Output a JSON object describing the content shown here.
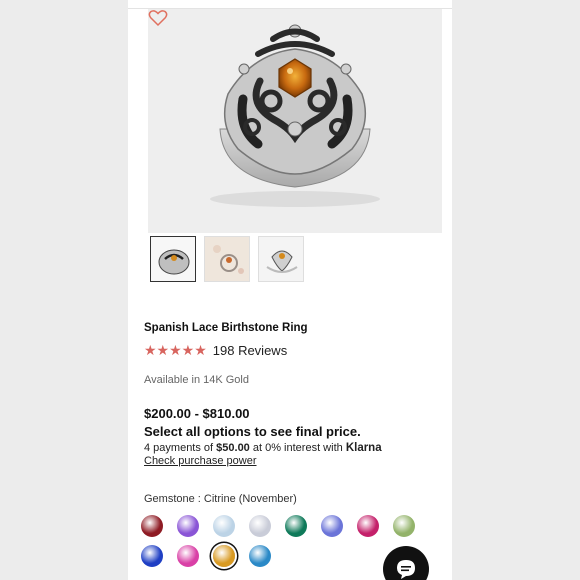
{
  "product": {
    "title": "Spanish Lace Birthstone Ring",
    "stars": "★★★★★",
    "rating_value": 5,
    "reviews": "198 Reviews",
    "availability": "Available in 14K Gold",
    "price_range": "$200.00 - $810.00",
    "select_note": "Select all options to see final price.",
    "klarna_prefix": "4 payments of ",
    "klarna_amount": "$50.00",
    "klarna_mid": " at 0% interest with ",
    "klarna_brand": "Klarna",
    "check_link": "Check purchase power"
  },
  "gemstone": {
    "label": "Gemstone : Citrine (November)",
    "swatches": [
      {
        "name": "garnet",
        "color": "#8e1b24"
      },
      {
        "name": "amethyst",
        "color": "#8a55d6"
      },
      {
        "name": "aquamarine",
        "color": "#bcd3e6"
      },
      {
        "name": "diamond",
        "color": "#c9ccd8"
      },
      {
        "name": "emerald",
        "color": "#0f7a5a"
      },
      {
        "name": "alexandrite",
        "color": "#6b74d8"
      },
      {
        "name": "ruby",
        "color": "#c4206a"
      },
      {
        "name": "peridot",
        "color": "#93b36a"
      },
      {
        "name": "sapphire",
        "color": "#1f3fc4"
      },
      {
        "name": "pink-tourmaline",
        "color": "#d940a6"
      },
      {
        "name": "citrine",
        "color": "#d99a22",
        "selected": true
      },
      {
        "name": "blue-topaz",
        "color": "#2a89c7"
      }
    ]
  },
  "colors": {
    "star": "#d8655f",
    "heart": "#e0705f",
    "chat_bg": "#111111"
  }
}
